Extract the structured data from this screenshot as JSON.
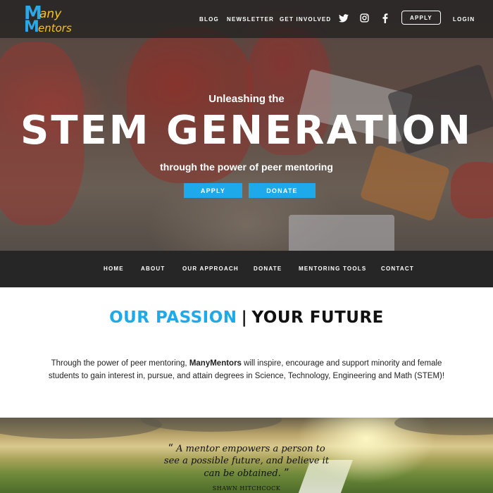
{
  "logo": {
    "line1_letter": "M",
    "line1_text": "any",
    "line2_letter": "M",
    "line2_text": "entors"
  },
  "topnav": {
    "blog": "BLOG",
    "newsletter": "NEWSLETTER",
    "get_involved": "GET INVOLVED",
    "apply": "APPLY",
    "login": "LOGIN"
  },
  "icons": {
    "twitter": "twitter-icon",
    "instagram": "instagram-icon",
    "facebook": "facebook-icon"
  },
  "hero": {
    "subtitle": "Unleashing the",
    "title": "STEM GENERATION",
    "tagline": "through the power of peer mentoring",
    "apply_button": "APPLY",
    "donate_button": "DONATE"
  },
  "mainnav": {
    "home": "HOME",
    "about": "ABOUT",
    "approach": "OUR APPROACH",
    "donate": "DONATE",
    "tools": "MENTORING TOOLS",
    "contact": "CONTACT"
  },
  "passion": {
    "part1": "OUR PASSION",
    "separator": "|",
    "part2": "YOUR FUTURE"
  },
  "mission": {
    "before": "Through the power of peer mentoring, ",
    "brand": "ManyMentors",
    "after": " will inspire, encourage and support minority and female students to gain interest in, pursue, and attain degrees in Science, Technology, Engineering and Math (STEM)!"
  },
  "quote": {
    "open_mark": "“",
    "text": "A mentor empowers a person to see a possible future, and believe it can be obtained.",
    "close_mark": "”",
    "author": "SHAWN HITCHCOCK"
  },
  "colors": {
    "accent": "#1ea9ea",
    "nav_bg": "#262626",
    "logo_yellow": "#f5c51a"
  }
}
